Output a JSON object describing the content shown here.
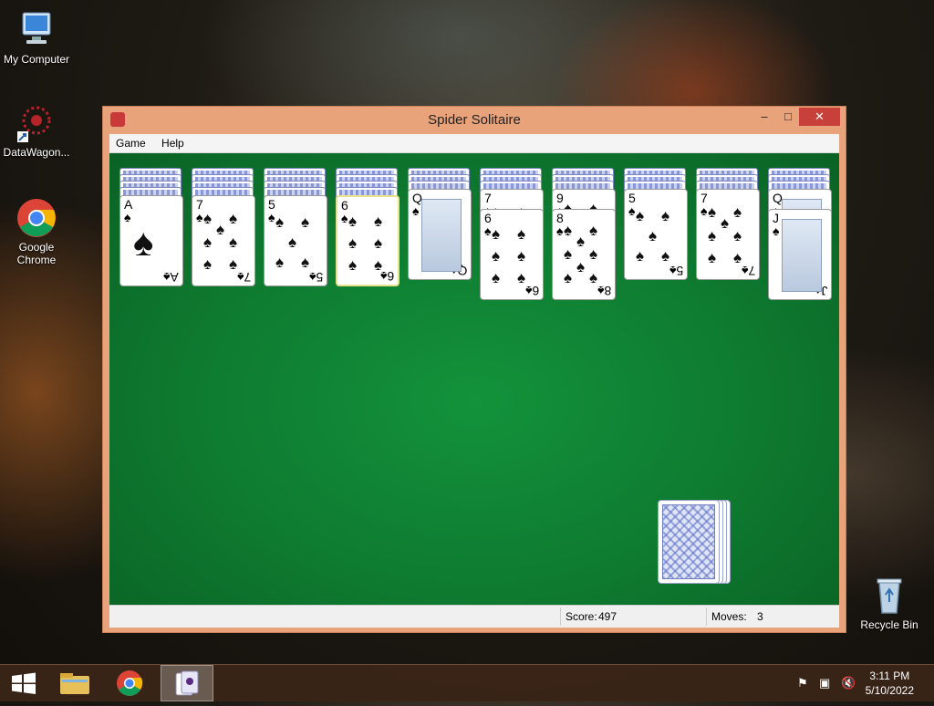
{
  "desktop": {
    "icons": [
      {
        "label": "My Computer",
        "icon": "computer-icon"
      },
      {
        "label": "DataWagon...",
        "icon": "datawagon-icon"
      },
      {
        "label": "Google Chrome",
        "icon": "chrome-icon"
      },
      {
        "label": "Recycle Bin",
        "icon": "recycle-bin-icon"
      }
    ]
  },
  "window": {
    "title": "Spider Solitaire",
    "controls": {
      "minimize": "–",
      "maximize": "□",
      "close": "✕"
    },
    "menu": [
      "Game",
      "Help"
    ],
    "status": {
      "score_label": "Score:",
      "score": "497",
      "moves_label": "Moves:",
      "moves": "3"
    }
  },
  "tableau": [
    {
      "backs": 4,
      "cards": [
        {
          "rank": "A",
          "suit": "♠",
          "face": false
        }
      ]
    },
    {
      "backs": 4,
      "cards": [
        {
          "rank": "7",
          "suit": "♠",
          "face": false
        }
      ]
    },
    {
      "backs": 4,
      "cards": [
        {
          "rank": "5",
          "suit": "♠",
          "face": false
        }
      ]
    },
    {
      "backs": 4,
      "cards": [
        {
          "rank": "6",
          "suit": "♠",
          "face": false,
          "highlighted": true
        }
      ]
    },
    {
      "backs": 3,
      "cards": [
        {
          "rank": "Q",
          "suit": "♠",
          "face": true
        }
      ]
    },
    {
      "backs": 3,
      "cards": [
        {
          "rank": "7",
          "suit": "♠",
          "face": false
        },
        {
          "rank": "6",
          "suit": "♠",
          "face": false
        }
      ]
    },
    {
      "backs": 3,
      "cards": [
        {
          "rank": "9",
          "suit": "♠",
          "face": false
        },
        {
          "rank": "8",
          "suit": "♠",
          "face": false
        }
      ]
    },
    {
      "backs": 3,
      "cards": [
        {
          "rank": "5",
          "suit": "♠",
          "face": false
        }
      ]
    },
    {
      "backs": 3,
      "cards": [
        {
          "rank": "7",
          "suit": "♠",
          "face": false
        }
      ]
    },
    {
      "backs": 3,
      "cards": [
        {
          "rank": "Q",
          "suit": "♠",
          "face": true
        },
        {
          "rank": "J",
          "suit": "♠",
          "face": true
        }
      ]
    }
  ],
  "stock_piles": 4,
  "taskbar": {
    "items": [
      "start-icon",
      "file-explorer-icon",
      "chrome-icon",
      "spider-solitaire-icon"
    ],
    "active": "spider-solitaire-icon",
    "tray": [
      "action-center-flag-icon",
      "network-icon",
      "volume-muted-icon"
    ],
    "time": "3:11 PM",
    "date": "5/10/2022"
  }
}
